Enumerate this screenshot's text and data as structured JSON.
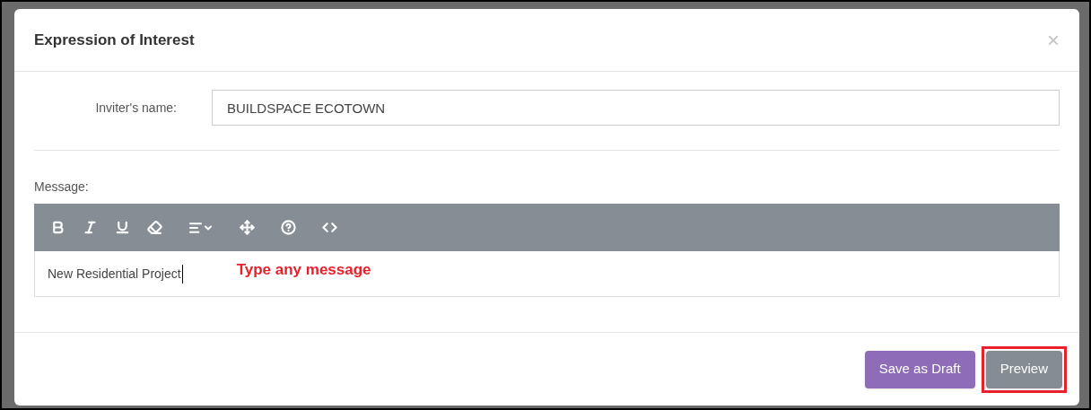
{
  "dialog": {
    "title": "Expression of Interest",
    "close": "×"
  },
  "inviter": {
    "label": "Inviter's name:",
    "value": "BUILDSPACE ECOTOWN"
  },
  "message": {
    "label": "Message:",
    "value": "New Residential Project",
    "annotation": "Type any message"
  },
  "buttons": [
    {
      "label": "Save as Draft",
      "kind": "primary",
      "highlighted": false
    },
    {
      "label": "Preview",
      "kind": "secondary",
      "highlighted": true
    }
  ]
}
